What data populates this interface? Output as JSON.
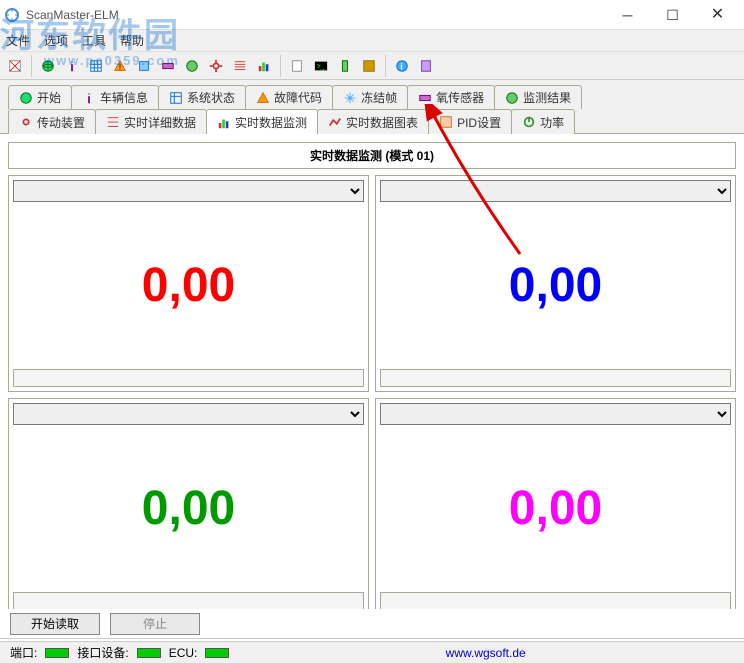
{
  "window": {
    "title": "ScanMaster-ELM"
  },
  "watermark": {
    "text": "河东软件园",
    "url": "www.pc0359.com"
  },
  "menu": {
    "file": "文件",
    "options": "选项",
    "tools": "工具",
    "help": "帮助"
  },
  "tabs": {
    "row1": [
      {
        "label": "开始",
        "icon": "globe"
      },
      {
        "label": "车辆信息",
        "icon": "info"
      },
      {
        "label": "系统状态",
        "icon": "system"
      },
      {
        "label": "故障代码",
        "icon": "warning"
      },
      {
        "label": "冻结帧",
        "icon": "snow"
      },
      {
        "label": "氧传感器",
        "icon": "sensor"
      },
      {
        "label": "监测结果",
        "icon": "monitor"
      }
    ],
    "row2": [
      {
        "label": "传动装置",
        "icon": "gear"
      },
      {
        "label": "实时详细数据",
        "icon": "list"
      },
      {
        "label": "实时数据监测",
        "icon": "chart",
        "active": true
      },
      {
        "label": "实时数据图表",
        "icon": "graph"
      },
      {
        "label": "PID设置",
        "icon": "pid"
      },
      {
        "label": "功率",
        "icon": "power"
      }
    ]
  },
  "panel": {
    "title": "实时数据监测 (模式 01)"
  },
  "gauges": [
    {
      "value": "0,00",
      "color": "red"
    },
    {
      "value": "0,00",
      "color": "blue"
    },
    {
      "value": "0,00",
      "color": "green"
    },
    {
      "value": "0,00",
      "color": "magenta"
    }
  ],
  "buttons": {
    "start": "开始读取",
    "stop": "停止"
  },
  "status": {
    "port": "端口:",
    "iface": "接口设备:",
    "ecu": "ECU:",
    "link": "www.wgsoft.de"
  }
}
